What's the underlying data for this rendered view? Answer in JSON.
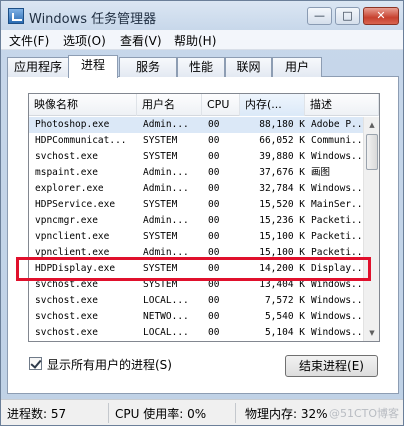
{
  "window": {
    "title": "Windows 任务管理器"
  },
  "caption_buttons": {
    "minimize": "—",
    "maximize": "□",
    "close": "✕"
  },
  "menu": [
    {
      "label": "文件(F)"
    },
    {
      "label": "选项(O)"
    },
    {
      "label": "查看(V)"
    },
    {
      "label": "帮助(H)"
    }
  ],
  "tabs": [
    {
      "label": "应用程序",
      "active": false
    },
    {
      "label": "进程",
      "active": true
    },
    {
      "label": "服务",
      "active": false
    },
    {
      "label": "性能",
      "active": false
    },
    {
      "label": "联网",
      "active": false
    },
    {
      "label": "用户",
      "active": false
    }
  ],
  "columns": [
    {
      "label": "映像名称"
    },
    {
      "label": "用户名"
    },
    {
      "label": "CPU"
    },
    {
      "label": "内存(..."
    },
    {
      "label": "描述"
    }
  ],
  "processes": [
    {
      "name": "Photoshop.exe",
      "user": "Admin...",
      "cpu": "00",
      "mem": "88,180 K",
      "desc": "Adobe P...",
      "selected": true
    },
    {
      "name": "HDPCommunicat...",
      "user": "SYSTEM",
      "cpu": "00",
      "mem": "66,052 K",
      "desc": "Communi..."
    },
    {
      "name": "svchost.exe",
      "user": "SYSTEM",
      "cpu": "00",
      "mem": "39,880 K",
      "desc": "Windows..."
    },
    {
      "name": "mspaint.exe",
      "user": "Admin...",
      "cpu": "00",
      "mem": "37,676 K",
      "desc": "画图"
    },
    {
      "name": "explorer.exe",
      "user": "Admin...",
      "cpu": "00",
      "mem": "32,784 K",
      "desc": "Windows..."
    },
    {
      "name": "HDPService.exe",
      "user": "SYSTEM",
      "cpu": "00",
      "mem": "15,520 K",
      "desc": "MainSer..."
    },
    {
      "name": "vpncmgr.exe",
      "user": "Admin...",
      "cpu": "00",
      "mem": "15,236 K",
      "desc": "Packeti..."
    },
    {
      "name": "vpnclient.exe",
      "user": "SYSTEM",
      "cpu": "00",
      "mem": "15,100 K",
      "desc": "Packeti..."
    },
    {
      "name": "vpnclient.exe",
      "user": "Admin...",
      "cpu": "00",
      "mem": "15,100 K",
      "desc": "Packeti..."
    },
    {
      "name": "HDPDisplay.exe",
      "user": "SYSTEM",
      "cpu": "00",
      "mem": "14,200 K",
      "desc": "Display..."
    },
    {
      "name": "svchost.exe",
      "user": "SYSTEM",
      "cpu": "00",
      "mem": "13,404 K",
      "desc": "Windows..."
    },
    {
      "name": "svchost.exe",
      "user": "LOCAL...",
      "cpu": "00",
      "mem": "7,572 K",
      "desc": "Windows..."
    },
    {
      "name": "svchost.exe",
      "user": "NETWO...",
      "cpu": "00",
      "mem": "5,540 K",
      "desc": "Windows..."
    },
    {
      "name": "svchost.exe",
      "user": "LOCAL...",
      "cpu": "00",
      "mem": "5,104 K",
      "desc": "Windows..."
    }
  ],
  "scrollbar": {
    "up": "▲",
    "down": "▼"
  },
  "show_all_users": {
    "label": "显示所有用户的进程(S)",
    "checked": true
  },
  "end_process_button": "结束进程(E)",
  "status": {
    "process_count": "进程数: 57",
    "cpu_usage": "CPU 使用率: 0%",
    "physical_memory": "物理内存: 32%"
  },
  "watermark": "@51CTO博客",
  "colors": {
    "highlight_box": "#e0102c",
    "selected_row": "#dbe8f7"
  }
}
